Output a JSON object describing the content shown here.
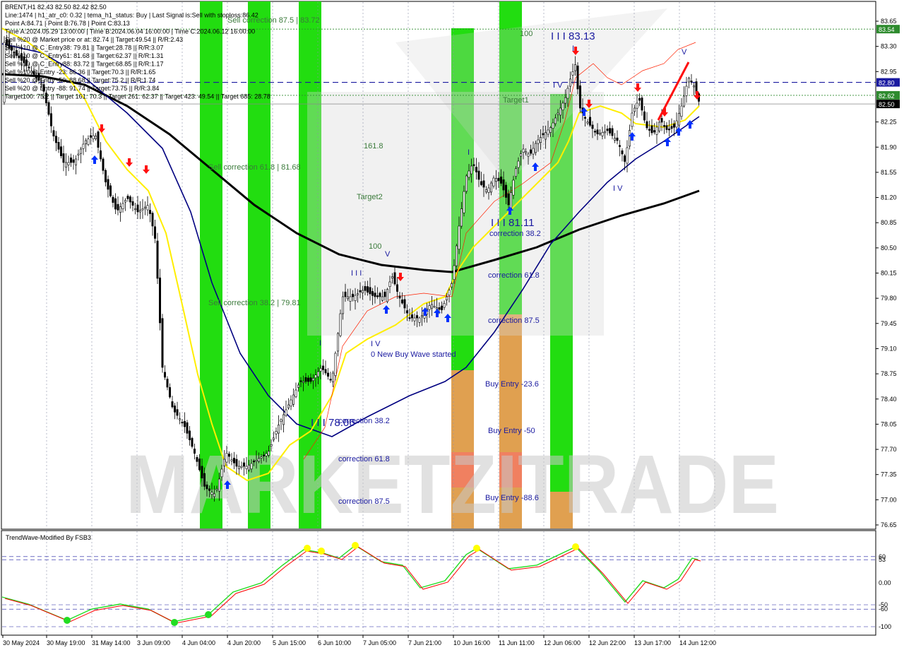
{
  "colors": {
    "background": "#ffffff",
    "panel_bg": "#ffffff",
    "grid": "#8b8fa8",
    "text": "#000000",
    "zone_green": "#22dd10",
    "zone_green_dark": "#33cc11",
    "zone_orange": "#e0a050",
    "zone_salmon": "#f08060",
    "ema_navy": "#000080",
    "ema_black": "#000000",
    "ema_yellow": "#ffee00",
    "candle": "#000000",
    "arrow_up": "#0030ff",
    "arrow_down": "#ff1010",
    "envelope": "#ff2000",
    "osc_green": "#22dd22",
    "osc_red": "#ff0000",
    "osc_dot": "#ffff00",
    "label_green": "#3a7a3a",
    "label_blue": "#1a1aa0",
    "price_tag_green": "#2e8b2e",
    "price_tag_blue": "#1a1aa0",
    "price_tag_black": "#000000"
  },
  "info_lines": [
    "BRENT,H1  82.43 82.50 82.42 82.50",
    "Line:1474 | h1_atr_c0: 0.32 | tema_h1_status: Buy | Last Signal is:Sell with stoploss:86.42",
    "Point A:84.71 | Point B:76.78 | Point C:83.13",
    "Time A:2024.05.29 13:00:00 | Time B:2024.06.04 16:00:00 | Time C:2024.06.12 16:00:00",
    "Sell %20 @ Market price or at: 82.74 || Target:49.54 || R/R:2.43",
    "Sell %10 @ C_Entry38: 79.81 || Target:28.78 || R/R:3.07",
    "Sell %10 @ C_Entry61: 81.68 || Target:62.37 || R/R:1.31",
    "Sell %10 @ C_Entry88: 83.72 || Target:68.85 || R/R:1.17",
    "Sell %10 @ Entry -23: 86.36 || Target:70.3 || R/R:1.65",
    "Sell %20 @ Entry -50: 88.68 || Target:75.2 || R/R:1.74",
    "Sell %20 @ Entry -88: 91.74 || Target:73.75 || R/R:3.84",
    "Target100: 75.2 || Target 161: 70.3 || Target 261: 62.37 || Target 423: 49.54 || Target 685: 28.78"
  ],
  "watermark": "MARKETZITRADE",
  "oscillator_title": "TrendWave-Modified By FSB3",
  "chart_data": {
    "type": "candlestick",
    "symbol": "BRENT",
    "timeframe": "H1",
    "ylim": [
      76.5,
      83.7
    ],
    "y_ticks": [
      76.65,
      77.0,
      77.35,
      77.7,
      78.05,
      78.4,
      78.75,
      79.1,
      79.45,
      79.8,
      80.15,
      80.5,
      80.85,
      81.2,
      81.55,
      81.9,
      82.25,
      82.95,
      83.3,
      83.65
    ],
    "price_tags": [
      {
        "value": 83.54,
        "label": "83.54",
        "kind": "green"
      },
      {
        "value": 82.8,
        "label": "82.80",
        "kind": "blue"
      },
      {
        "value": 82.62,
        "label": "82.62",
        "kind": "green"
      },
      {
        "value": 82.5,
        "label": "82.50",
        "kind": "black"
      }
    ],
    "x_labels": [
      "30 May 2024",
      "30 May 19:00",
      "31 May 14:00",
      "3 Jun 09:00",
      "4 Jun 04:00",
      "4 Jun 20:00",
      "5 Jun 15:00",
      "6 Jun 10:00",
      "7 Jun 05:00",
      "7 Jun 21:00",
      "10 Jun 16:00",
      "11 Jun 11:00",
      "12 Jun 06:00",
      "12 Jun 22:00",
      "13 Jun 17:00",
      "14 Jun 12:00"
    ],
    "horizontal_levels": [
      {
        "value": 83.54,
        "style": "dotted",
        "color": "green"
      },
      {
        "value": 82.8,
        "style": "dashed",
        "color": "blue"
      },
      {
        "value": 82.62,
        "style": "dotted",
        "color": "green"
      },
      {
        "value": 82.5,
        "style": "solid",
        "color": "gray"
      }
    ],
    "zone_labels": [
      {
        "text": "Sell correction 87.5 | 83.72",
        "color": "green"
      },
      {
        "text": "Sell correction 61.8 | 81.68",
        "color": "green"
      },
      {
        "text": "Sell correction 38.2 | 79.81",
        "color": "green"
      },
      {
        "text": "161.8",
        "color": "green"
      },
      {
        "text": "Target2",
        "color": "green"
      },
      {
        "text": "100",
        "color": "green"
      },
      {
        "text": "Target1",
        "color": "green"
      },
      {
        "text": "100",
        "color": "green"
      },
      {
        "text": "0 New Buy Wave started",
        "color": "blue"
      },
      {
        "text": "correction 38.2",
        "color": "blue"
      },
      {
        "text": "correction 61.8",
        "color": "blue"
      },
      {
        "text": "correction 87.5",
        "color": "blue"
      },
      {
        "text": "Buy Entry -23.6",
        "color": "blue"
      },
      {
        "text": "Buy Entry -50",
        "color": "blue"
      },
      {
        "text": "Buy Entry -88.6",
        "color": "blue"
      },
      {
        "text": "correction 38.2",
        "color": "blue"
      },
      {
        "text": "correction 61.8",
        "color": "blue"
      },
      {
        "text": "correction 87.5",
        "color": "blue"
      }
    ],
    "wave_labels": [
      {
        "text": "I I I 83.13"
      },
      {
        "text": "I I I 81.11"
      },
      {
        "text": "I I I 78.06"
      },
      {
        "text": "I I I"
      },
      {
        "text": "I V"
      },
      {
        "text": "I V"
      },
      {
        "text": "I V"
      },
      {
        "text": "V"
      },
      {
        "text": "V"
      },
      {
        "text": "I"
      },
      {
        "text": "I"
      },
      {
        "text": "I"
      }
    ],
    "oscillator": {
      "ylim": [
        -110,
        110
      ],
      "y_ticks": [
        60,
        53,
        0.0,
        -50,
        -60,
        -100
      ],
      "y_tick_labels": [
        "60",
        "53",
        "0.00",
        "-50",
        "-60",
        "-100"
      ]
    }
  }
}
